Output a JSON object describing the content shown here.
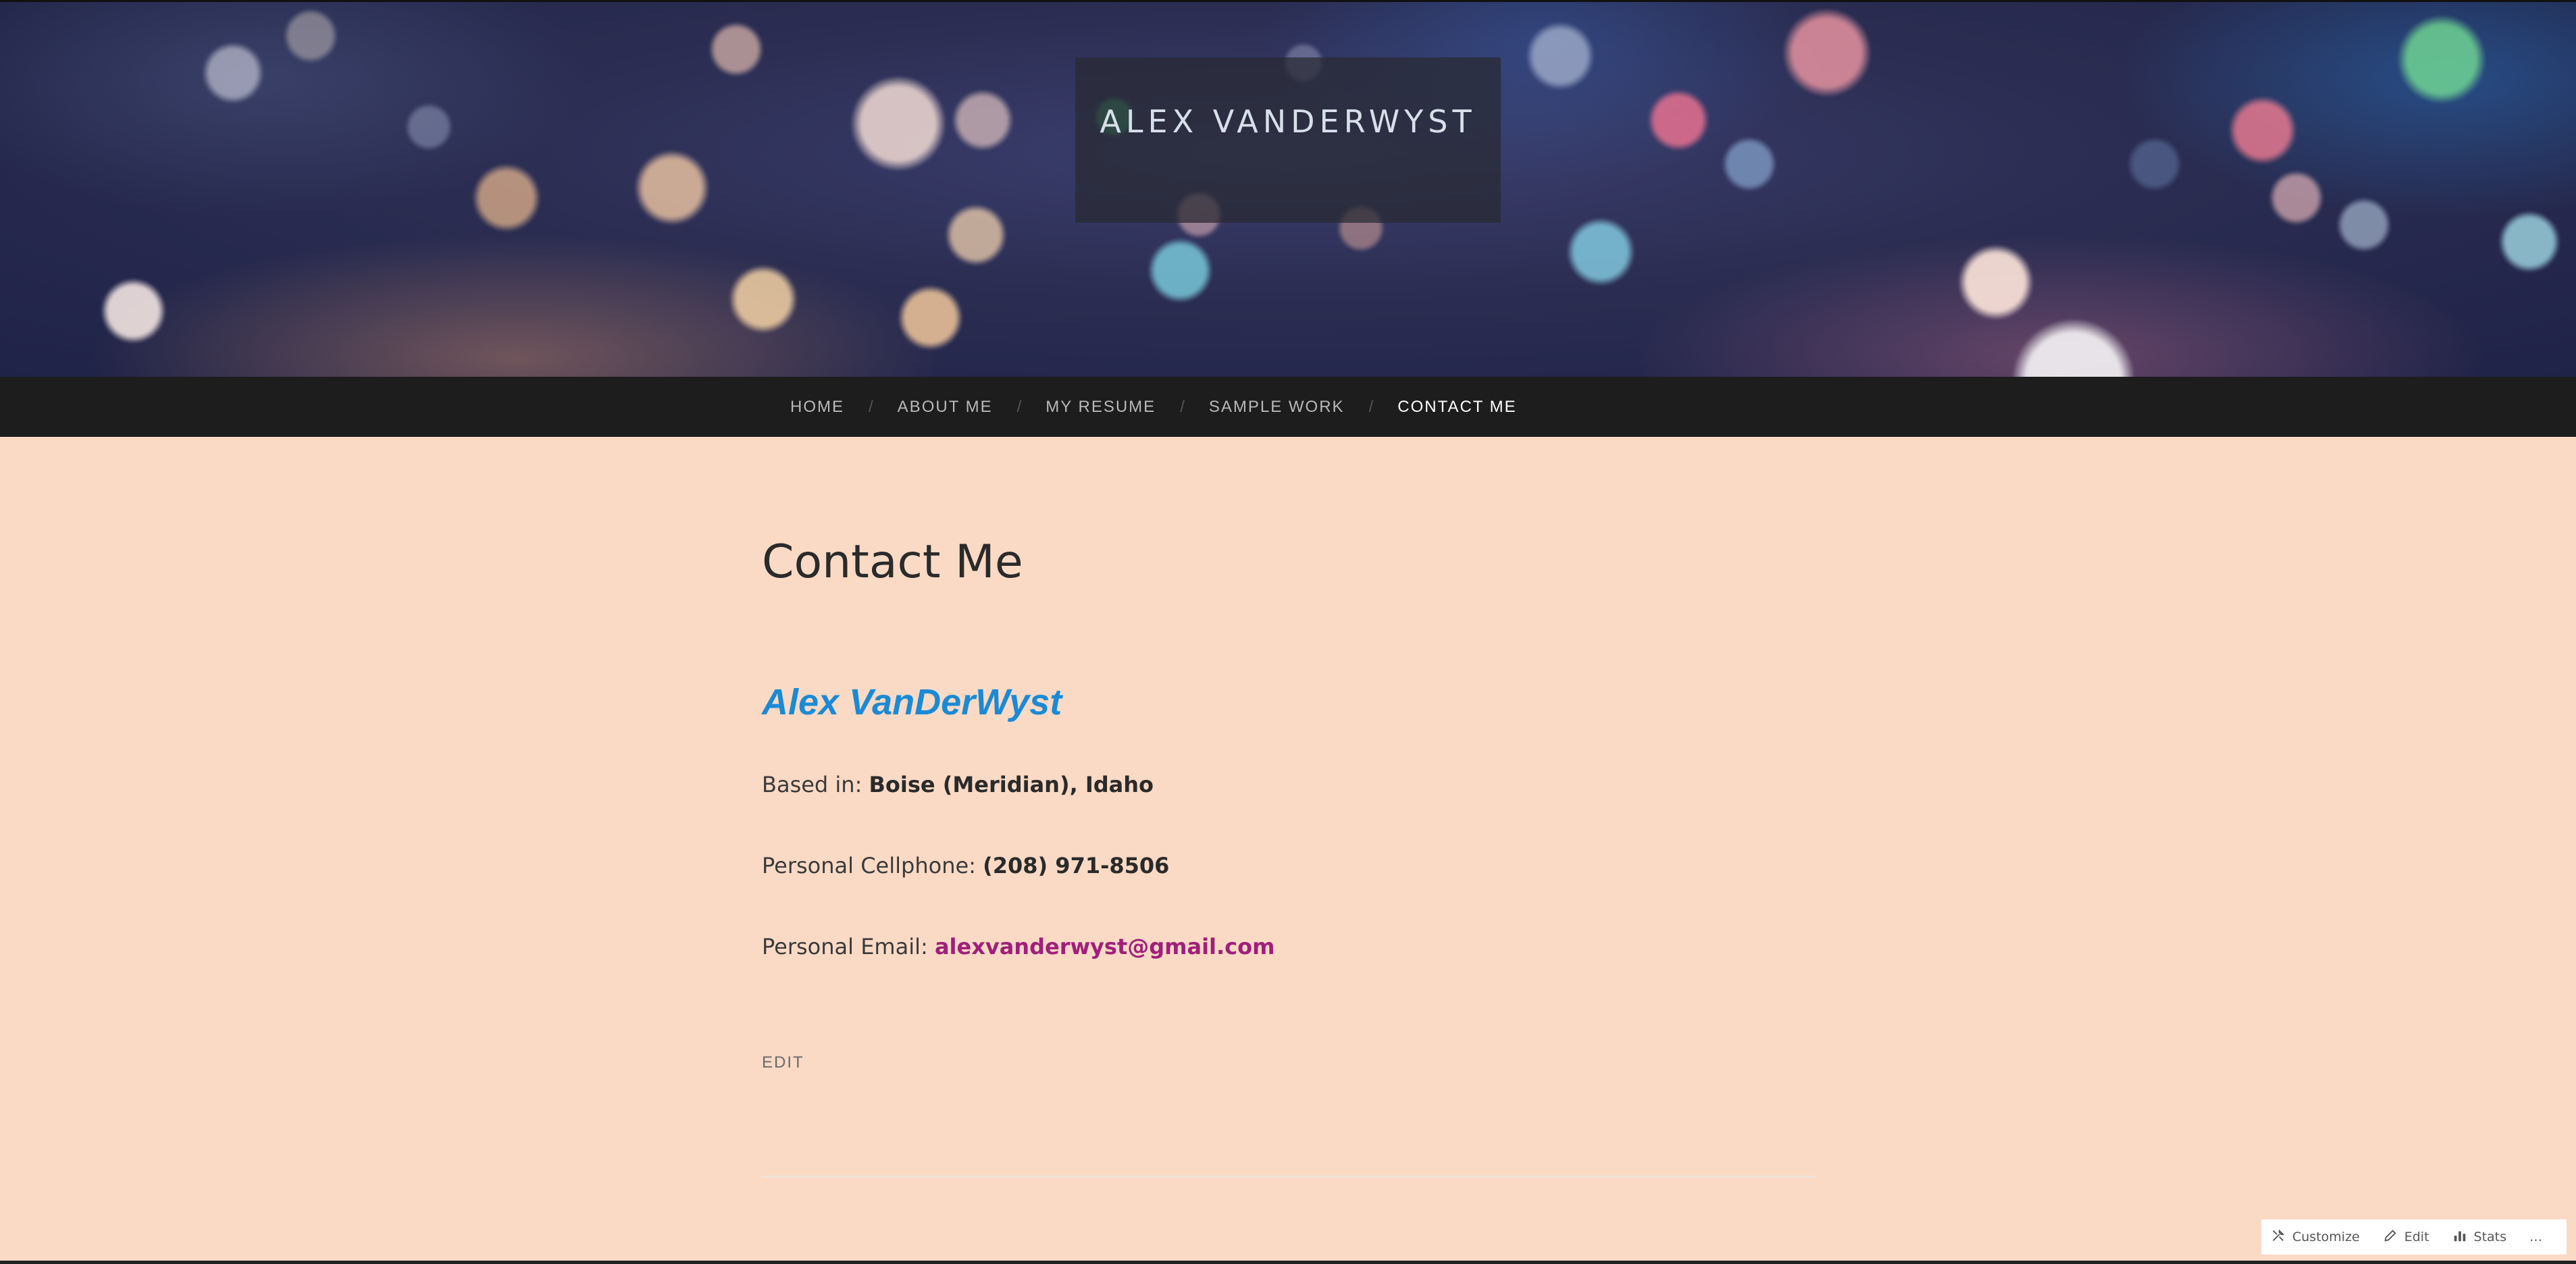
{
  "header": {
    "site_title": "ALEX VANDERWYST"
  },
  "nav": {
    "items": [
      {
        "label": "HOME"
      },
      {
        "label": "ABOUT ME"
      },
      {
        "label": "MY RESUME"
      },
      {
        "label": "SAMPLE WORK"
      },
      {
        "label": "CONTACT ME",
        "active": true
      }
    ],
    "separator": "/"
  },
  "main": {
    "page_title": "Contact Me",
    "contact_name": "Alex VanDerWyst",
    "based_in_label": "Based in:",
    "based_in_value": "Boise (Meridian), Idaho",
    "phone_label": "Personal Cellphone:",
    "phone_value": "(208) 971-8506",
    "email_label": "Personal Email:",
    "email_value": "alexvanderwyst@gmail.com",
    "edit_label": "EDIT"
  },
  "admin_bar": {
    "customize_label": "Customize",
    "edit_label": "Edit",
    "stats_label": "Stats",
    "more_label": "…"
  },
  "colors": {
    "page_background": "#fadac5",
    "nav_background": "#1d1d1d",
    "name_link": "#1a8ad6",
    "email_link": "#a01f7a"
  }
}
